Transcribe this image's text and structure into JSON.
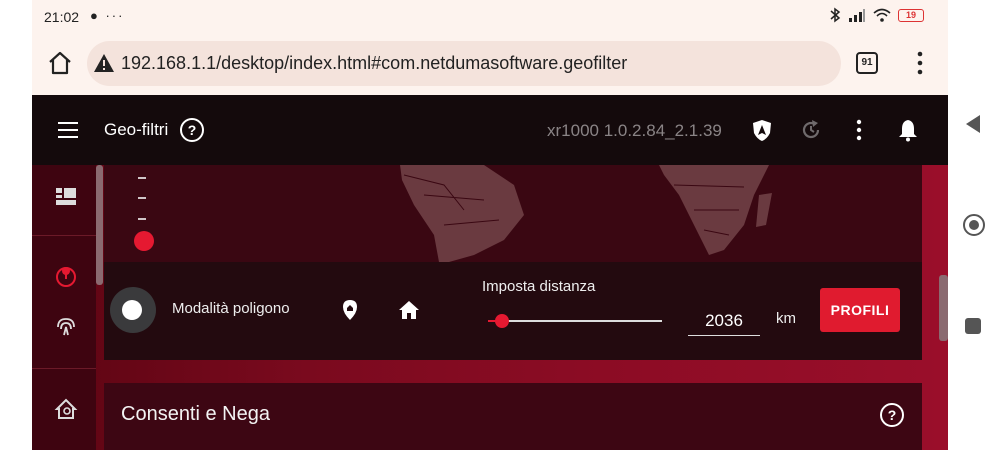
{
  "statusbar": {
    "time": "21:02",
    "left_icons": "● ···",
    "battery": "19"
  },
  "browser": {
    "url": "192.168.1.1/desktop/index.html#com.netdumasoftware.geofilter",
    "tab_count": "91"
  },
  "header": {
    "title": "Geo-filtri",
    "help": "?",
    "version": "xr1000 1.0.2.84_2.1.39"
  },
  "controls": {
    "polygon_mode_label": "Modalità poligono",
    "distance_label": "Imposta distanza",
    "distance_value": "2036",
    "distance_fraction": 0.08,
    "unit": "km",
    "profiles_button": "PROFILI"
  },
  "card": {
    "title": "Consenti e Nega",
    "help": "?"
  },
  "colors": {
    "accent": "#e01b2f",
    "header_bg": "#140a0c",
    "main_bg": "#7a0a1e"
  }
}
